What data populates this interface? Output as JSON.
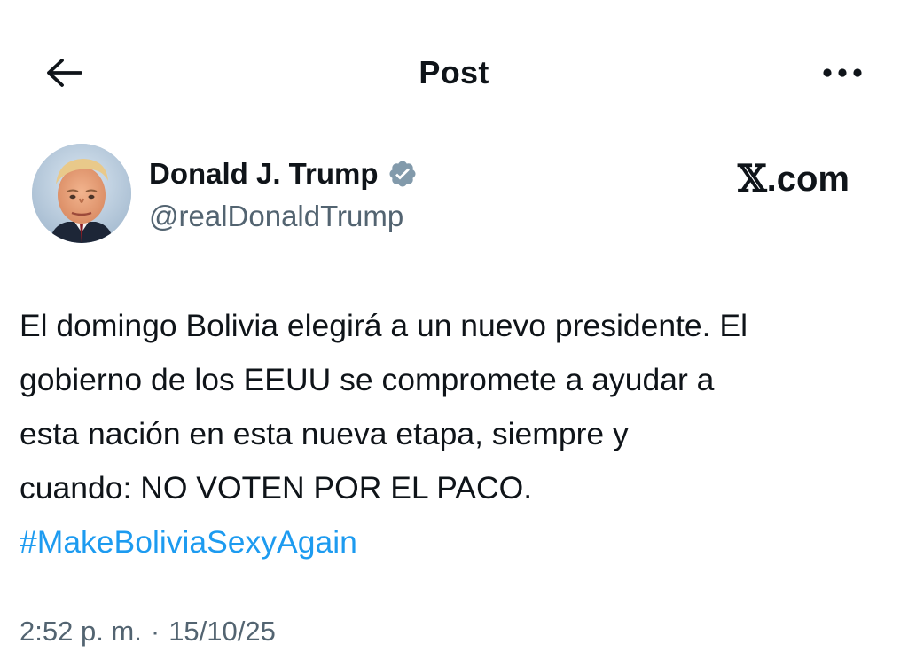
{
  "header": {
    "title": "Post",
    "back_icon": "arrow-left-icon",
    "more_icon": "ellipsis-horizontal-icon"
  },
  "author": {
    "name": "Donald J. Trump",
    "handle": "@realDonaldTrump",
    "verified_icon": "verified-badge-icon",
    "verified_color": "#829aab",
    "avatar_icon": "profile-photo"
  },
  "brand": {
    "x_glyph": "𝕏",
    "suffix": ".com"
  },
  "post": {
    "text": "El domingo Bolivia elegirá a un nuevo presidente. El\ngobierno de los EEUU se compromete a ayudar a\nesta nación en esta nueva etapa, siempre y\ncuando: NO VOTEN POR EL PACO.",
    "hashtag": "#MakeBoliviaSexyAgain",
    "hashtag_color": "#1d9bf0"
  },
  "meta": {
    "time": "2:52 p. m.",
    "separator": "·",
    "date": "15/10/25"
  }
}
